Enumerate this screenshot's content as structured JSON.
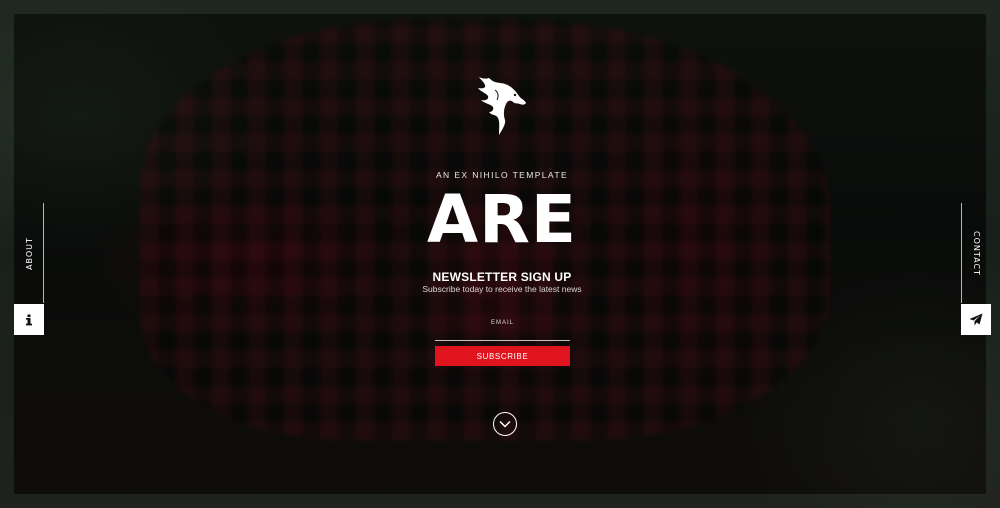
{
  "brand": {
    "tagline": "AN EX NIHILO TEMPLATE",
    "title": "ARE"
  },
  "newsletter": {
    "title": "NEWSLETTER SIGN UP",
    "subtitle": "Subscribe today to receive the latest news",
    "email_label": "EMAIL",
    "email_value": "",
    "subscribe_label": "SUBSCRIBE"
  },
  "side_nav": {
    "left": {
      "label": "ABOUT",
      "icon": "info-icon"
    },
    "right": {
      "label": "CONTACT",
      "icon": "paper-plane-icon"
    }
  },
  "scroll": {
    "icon": "chevron-down-icon"
  },
  "colors": {
    "accent": "#e0141f",
    "overlay": "#000000",
    "text": "#ffffff"
  }
}
